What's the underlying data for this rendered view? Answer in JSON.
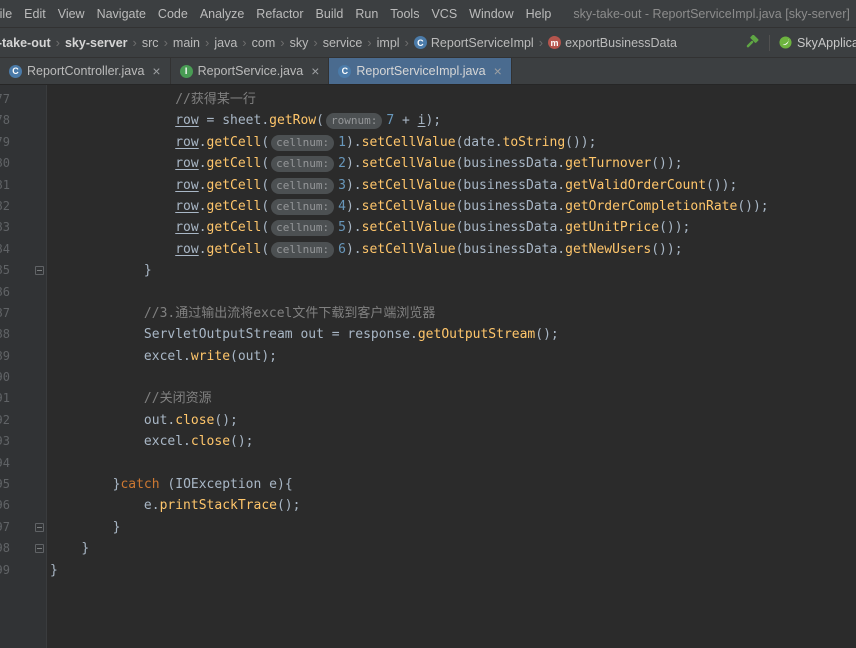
{
  "window": {
    "title": "sky-take-out - ReportServiceImpl.java [sky-server]"
  },
  "menubar": {
    "items": [
      "File",
      "Edit",
      "View",
      "Navigate",
      "Code",
      "Analyze",
      "Refactor",
      "Build",
      "Run",
      "Tools",
      "VCS",
      "Window",
      "Help"
    ]
  },
  "breadcrumbs": {
    "path": [
      "sky-take-out",
      "sky-server",
      "src",
      "main",
      "java",
      "com",
      "sky",
      "service",
      "impl"
    ],
    "bold_count": 2,
    "class_item": {
      "label": "ReportServiceImpl",
      "icon": "class-icon",
      "letter": "C"
    },
    "method_item": {
      "label": "exportBusinessData",
      "icon": "method-icon",
      "letter": "m"
    }
  },
  "toolbar": {
    "build_icon": "hammer-icon",
    "run_config": {
      "icon": "spring-boot-icon",
      "label": "SkyApplication"
    }
  },
  "tabs": [
    {
      "label": "ReportController.java",
      "icon": "class-icon",
      "letter": "C",
      "active": false
    },
    {
      "label": "ReportService.java",
      "icon": "interface-icon",
      "letter": "I",
      "active": false
    },
    {
      "label": "ReportServiceImpl.java",
      "icon": "class-icon",
      "letter": "C",
      "active": true
    }
  ],
  "theme": {
    "colors": {
      "editor_bg": "#2B2B2B",
      "bar_bg": "#3C3F41",
      "gutter_bg": "#313335",
      "line_number": "#606366",
      "text": "#A9B7C6",
      "comment": "#808080",
      "keyword": "#CC7832",
      "number": "#6897BB",
      "method": "#FFC66B",
      "hint_bg": "#4C5052",
      "hint_text": "#949698",
      "tab_active_bg": "#4A6B8F",
      "ui_text": "#BBBBBB",
      "class_icon": "#4B7BA9",
      "interface_icon": "#499C54",
      "method_icon": "#B5554D",
      "build_icon": "#5FA644"
    }
  },
  "editor": {
    "lines": [
      {
        "n": 77,
        "ind": 16,
        "tok": [
          [
            "cmt",
            "//获得某一行"
          ]
        ]
      },
      {
        "n": 78,
        "ind": 16,
        "tok": [
          [
            "v",
            "row"
          ],
          [
            "pl",
            " = sheet."
          ],
          [
            "m",
            "getRow"
          ],
          [
            "pl",
            "("
          ],
          [
            "hint",
            "rownum:"
          ],
          [
            "num",
            "7"
          ],
          [
            "pl",
            " + "
          ],
          [
            "v",
            "i"
          ],
          [
            "pl",
            ");"
          ]
        ]
      },
      {
        "n": 79,
        "ind": 16,
        "tok": [
          [
            "v",
            "row"
          ],
          [
            "pl",
            "."
          ],
          [
            "m",
            "getCell"
          ],
          [
            "pl",
            "("
          ],
          [
            "hint",
            "cellnum:"
          ],
          [
            "num",
            "1"
          ],
          [
            "pl",
            ")."
          ],
          [
            "m",
            "setCellValue"
          ],
          [
            "pl",
            "(date."
          ],
          [
            "m",
            "toString"
          ],
          [
            "pl",
            "());"
          ]
        ]
      },
      {
        "n": 80,
        "ind": 16,
        "tok": [
          [
            "v",
            "row"
          ],
          [
            "pl",
            "."
          ],
          [
            "m",
            "getCell"
          ],
          [
            "pl",
            "("
          ],
          [
            "hint",
            "cellnum:"
          ],
          [
            "num",
            "2"
          ],
          [
            "pl",
            ")."
          ],
          [
            "m",
            "setCellValue"
          ],
          [
            "pl",
            "(businessData."
          ],
          [
            "m",
            "getTurnover"
          ],
          [
            "pl",
            "());"
          ]
        ]
      },
      {
        "n": 81,
        "ind": 16,
        "tok": [
          [
            "v",
            "row"
          ],
          [
            "pl",
            "."
          ],
          [
            "m",
            "getCell"
          ],
          [
            "pl",
            "("
          ],
          [
            "hint",
            "cellnum:"
          ],
          [
            "num",
            "3"
          ],
          [
            "pl",
            ")."
          ],
          [
            "m",
            "setCellValue"
          ],
          [
            "pl",
            "(businessData."
          ],
          [
            "m",
            "getValidOrderCount"
          ],
          [
            "pl",
            "());"
          ]
        ]
      },
      {
        "n": 82,
        "ind": 16,
        "tok": [
          [
            "v",
            "row"
          ],
          [
            "pl",
            "."
          ],
          [
            "m",
            "getCell"
          ],
          [
            "pl",
            "("
          ],
          [
            "hint",
            "cellnum:"
          ],
          [
            "num",
            "4"
          ],
          [
            "pl",
            ")."
          ],
          [
            "m",
            "setCellValue"
          ],
          [
            "pl",
            "(businessData."
          ],
          [
            "m",
            "getOrderCompletionRate"
          ],
          [
            "pl",
            "());"
          ]
        ]
      },
      {
        "n": 83,
        "ind": 16,
        "tok": [
          [
            "v",
            "row"
          ],
          [
            "pl",
            "."
          ],
          [
            "m",
            "getCell"
          ],
          [
            "pl",
            "("
          ],
          [
            "hint",
            "cellnum:"
          ],
          [
            "num",
            "5"
          ],
          [
            "pl",
            ")."
          ],
          [
            "m",
            "setCellValue"
          ],
          [
            "pl",
            "(businessData."
          ],
          [
            "m",
            "getUnitPrice"
          ],
          [
            "pl",
            "());"
          ]
        ]
      },
      {
        "n": 84,
        "ind": 16,
        "tok": [
          [
            "v",
            "row"
          ],
          [
            "pl",
            "."
          ],
          [
            "m",
            "getCell"
          ],
          [
            "pl",
            "("
          ],
          [
            "hint",
            "cellnum:"
          ],
          [
            "num",
            "6"
          ],
          [
            "pl",
            ")."
          ],
          [
            "m",
            "setCellValue"
          ],
          [
            "pl",
            "(businessData."
          ],
          [
            "m",
            "getNewUsers"
          ],
          [
            "pl",
            "());"
          ]
        ]
      },
      {
        "n": 85,
        "ind": 12,
        "fold": true,
        "tok": [
          [
            "pl",
            "}"
          ]
        ]
      },
      {
        "n": 86,
        "ind": 0,
        "tok": []
      },
      {
        "n": 87,
        "ind": 12,
        "tok": [
          [
            "cmt",
            "//3.通过输出流将excel文件下载到客户端浏览器"
          ]
        ]
      },
      {
        "n": 88,
        "ind": 12,
        "tok": [
          [
            "pl",
            "ServletOutputStream out = response."
          ],
          [
            "m",
            "getOutputStream"
          ],
          [
            "pl",
            "();"
          ]
        ]
      },
      {
        "n": 89,
        "ind": 12,
        "tok": [
          [
            "pl",
            "excel."
          ],
          [
            "m",
            "write"
          ],
          [
            "pl",
            "(out);"
          ]
        ]
      },
      {
        "n": 90,
        "ind": 0,
        "tok": []
      },
      {
        "n": 91,
        "ind": 12,
        "tok": [
          [
            "cmt",
            "//关闭资源"
          ]
        ]
      },
      {
        "n": 92,
        "ind": 12,
        "tok": [
          [
            "pl",
            "out."
          ],
          [
            "m",
            "close"
          ],
          [
            "pl",
            "();"
          ]
        ]
      },
      {
        "n": 93,
        "ind": 12,
        "tok": [
          [
            "pl",
            "excel."
          ],
          [
            "m",
            "close"
          ],
          [
            "pl",
            "();"
          ]
        ]
      },
      {
        "n": 94,
        "ind": 0,
        "tok": []
      },
      {
        "n": 95,
        "ind": 8,
        "tok": [
          [
            "pl",
            "}"
          ],
          [
            "kw",
            "catch"
          ],
          [
            "pl",
            " (IOException e){"
          ]
        ]
      },
      {
        "n": 96,
        "ind": 12,
        "tok": [
          [
            "pl",
            "e."
          ],
          [
            "m",
            "printStackTrace"
          ],
          [
            "pl",
            "();"
          ]
        ]
      },
      {
        "n": 97,
        "ind": 8,
        "fold": true,
        "tok": [
          [
            "pl",
            "}"
          ]
        ]
      },
      {
        "n": 98,
        "ind": 4,
        "fold": true,
        "tok": [
          [
            "pl",
            "}"
          ]
        ]
      },
      {
        "n": 99,
        "ind": 0,
        "tok": [
          [
            "pl",
            "}"
          ]
        ]
      }
    ]
  }
}
